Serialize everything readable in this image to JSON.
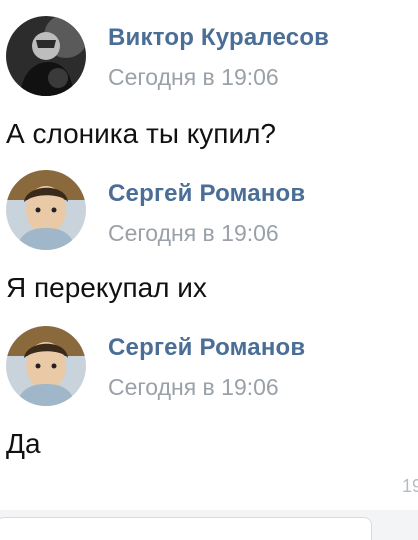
{
  "messages": [
    {
      "author": "Виктор Куралесов",
      "time": "Сегодня в 19:06",
      "text": "А слоника ты купил?"
    },
    {
      "author": "Сергей Романов",
      "time": "Сегодня в 19:06",
      "text": "Я перекупал их"
    },
    {
      "author": "Сергей Романов",
      "time": "Сегодня в 19:06",
      "text": "Да"
    }
  ],
  "partial_time": "19",
  "colors": {
    "author": "#4a6e96",
    "time": "#9aa1a8",
    "text": "#111111"
  }
}
